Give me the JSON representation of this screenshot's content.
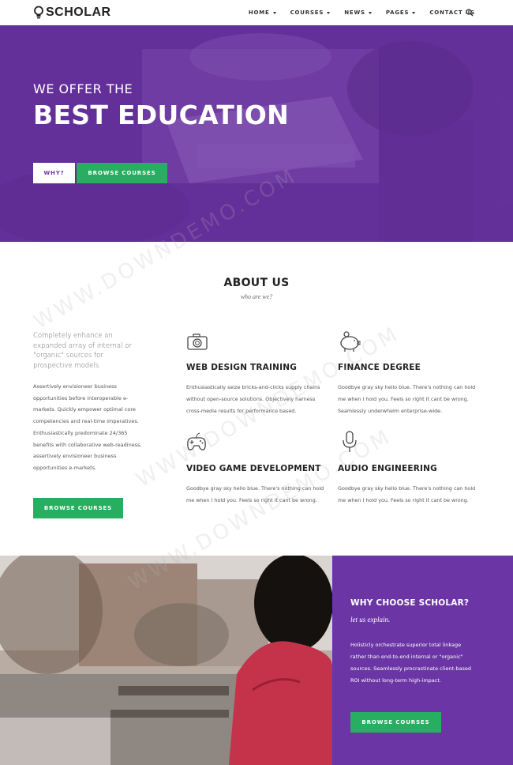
{
  "nav": {
    "logo_text": "SCHOLAR",
    "menu": [
      {
        "label": "HOME",
        "has_caret": true
      },
      {
        "label": "COURSES",
        "has_caret": true
      },
      {
        "label": "NEWS",
        "has_caret": true
      },
      {
        "label": "PAGES",
        "has_caret": true
      },
      {
        "label": "CONTACT US",
        "has_caret": false
      }
    ],
    "search_icon": "search-icon"
  },
  "hero": {
    "subtitle": "WE OFFER THE",
    "title": "BEST EDUCATION",
    "why_button": "WHY?",
    "browse_button": "BROWSE COURSES"
  },
  "about": {
    "title": "ABOUT US",
    "subtitle": "who are we?",
    "lead": "Completely enhance an expanded array of internal or \"organic\" sources for prospective models.",
    "body": "Assertively envisioneer business opportunities before interoperable e-markets. Quickly empower optimal core competencies and real-time imperatives. Enthusiastically predominate 24/365 benefits with collaborative web-readiness. assertively envisioneer business opportunities e-markets.",
    "browse_button": "BROWSE COURSES",
    "features": [
      {
        "icon": "camera-icon",
        "title": "WEB DESIGN TRAINING",
        "text": "Enthusiastically seize bricks-and-clicks supply chains without open-source solutions. Objectively harness cross-media results for performance based."
      },
      {
        "icon": "piggy-bank-icon",
        "title": "FINANCE DEGREE",
        "text": "Goodbye gray sky hello blue. There's nothing can hold me when I hold you. Feels so right it cant be wrong. Seamlessly underwhelm enterprise-wide."
      },
      {
        "icon": "gamepad-icon",
        "title": "VIDEO GAME DEVELOPMENT",
        "text": "Goodbye gray sky hello blue. There's nothing can hold me when I hold you. Feels so right it cant be wrong."
      },
      {
        "icon": "microphone-icon",
        "title": "AUDIO ENGINEERING",
        "text": "Goodbye gray sky hello blue. There's nothing can hold me when I hold you. Feels so right it cant be wrong."
      }
    ]
  },
  "why": {
    "title": "WHY CHOOSE SCHOLAR?",
    "subtitle": "let us explain.",
    "text": "Holisticly orchestrate superior total linkage rather than end-to-end internal or \"organic\" sources. Seamlessly procrastinate client-based ROI without long-term high-impact.",
    "browse_button": "BROWSE COURSES"
  },
  "watermark": "WWW.DOWNDEMO.COM",
  "colors": {
    "purple": "#6b35a6",
    "green": "#27ae60",
    "text_dark": "#222222"
  }
}
